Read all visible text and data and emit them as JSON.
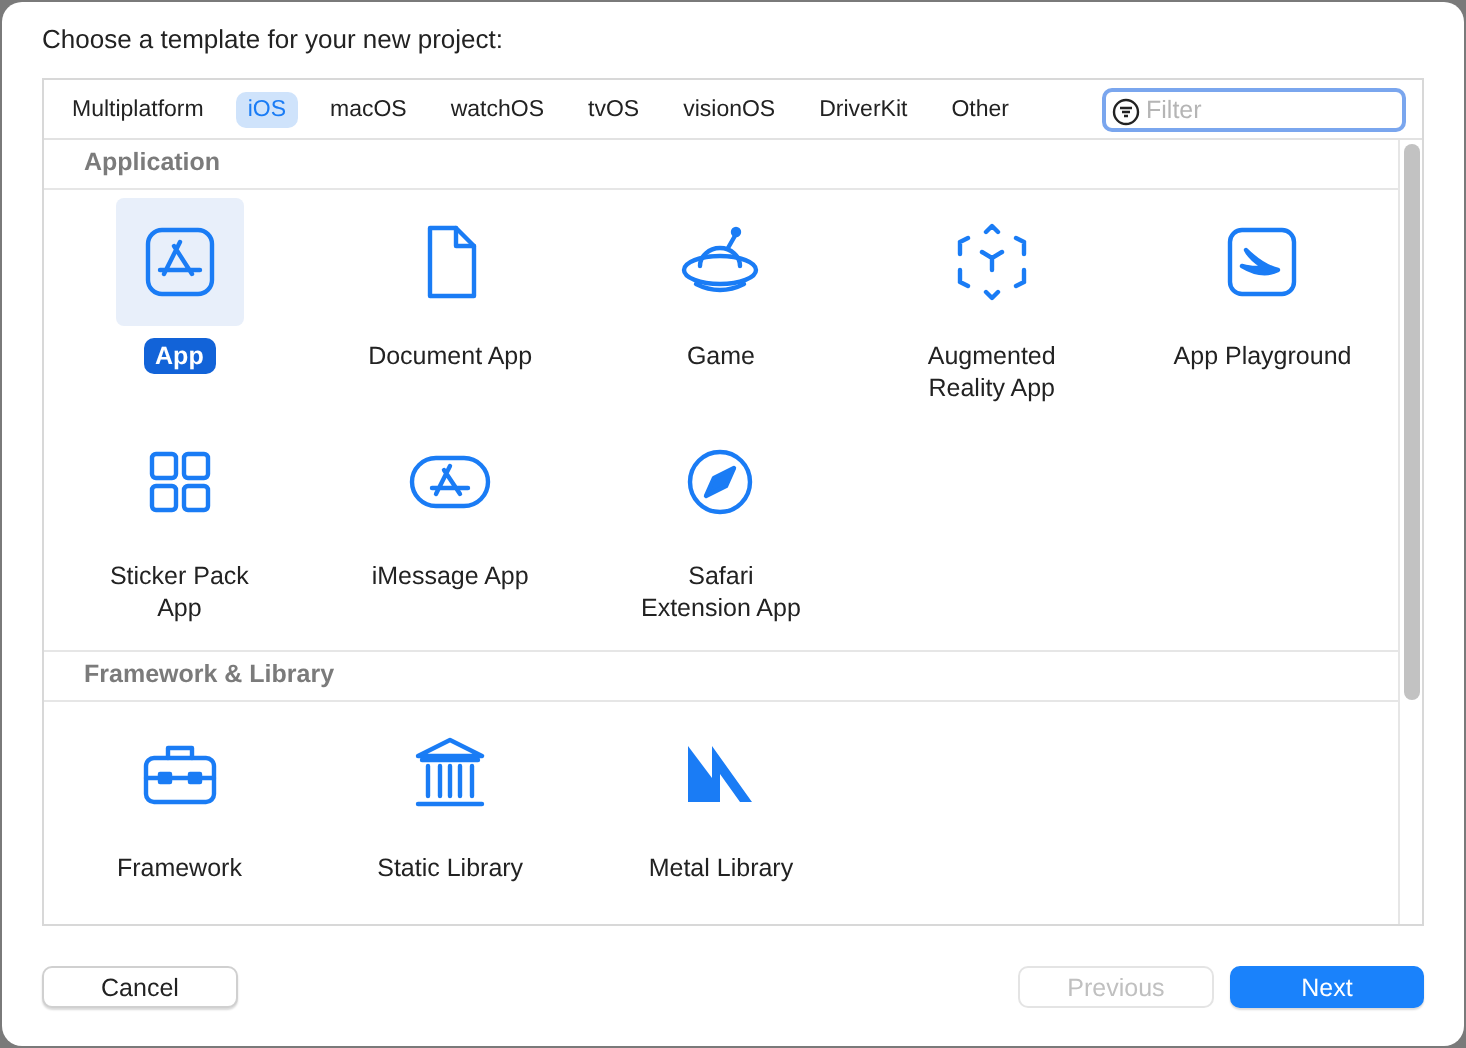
{
  "heading": "Choose a template for your new project:",
  "tabs": [
    {
      "label": "Multiplatform",
      "selected": false
    },
    {
      "label": "iOS",
      "selected": true
    },
    {
      "label": "macOS",
      "selected": false
    },
    {
      "label": "watchOS",
      "selected": false
    },
    {
      "label": "tvOS",
      "selected": false
    },
    {
      "label": "visionOS",
      "selected": false
    },
    {
      "label": "DriverKit",
      "selected": false
    },
    {
      "label": "Other",
      "selected": false
    }
  ],
  "filter": {
    "placeholder": "Filter"
  },
  "sections": [
    {
      "title": "Application",
      "templates": [
        {
          "label": "App",
          "kind": "app",
          "selected": true
        },
        {
          "label": "Document App",
          "kind": "document",
          "selected": false
        },
        {
          "label": "Game",
          "kind": "game",
          "selected": false
        },
        {
          "label": "Augmented Reality App",
          "kind": "ar",
          "selected": false
        },
        {
          "label": "App Playground",
          "kind": "playground",
          "selected": false
        },
        {
          "label": "Sticker Pack App",
          "kind": "sticker",
          "selected": false
        },
        {
          "label": "iMessage App",
          "kind": "imessage",
          "selected": false
        },
        {
          "label": "Safari Extension App",
          "kind": "safari",
          "selected": false
        }
      ]
    },
    {
      "title": "Framework & Library",
      "templates": [
        {
          "label": "Framework",
          "kind": "framework",
          "selected": false
        },
        {
          "label": "Static Library",
          "kind": "library",
          "selected": false
        },
        {
          "label": "Metal Library",
          "kind": "metal",
          "selected": false
        }
      ]
    }
  ],
  "buttons": [
    {
      "label": "Cancel",
      "kind": "plain",
      "disabled": false
    },
    {
      "label": "Previous",
      "kind": "plain",
      "disabled": true
    },
    {
      "label": "Next",
      "kind": "primary",
      "disabled": false
    }
  ]
}
